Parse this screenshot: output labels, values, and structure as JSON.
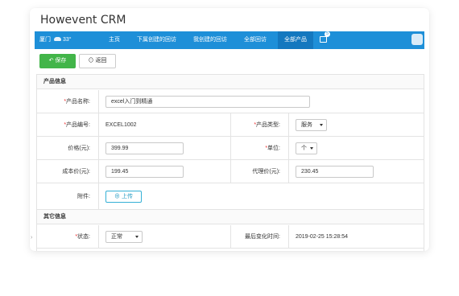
{
  "app": {
    "title": "Howevent CRM"
  },
  "navbar": {
    "city": "厦门",
    "temperature": "33°",
    "items": [
      "主页",
      "下属创建的回访",
      "我创建的回访",
      "全部回访",
      "全部产品"
    ],
    "active_index": 4,
    "message_count": "5"
  },
  "toolbar": {
    "save_label": "保存",
    "back_label": "返回"
  },
  "form": {
    "section_product": "产品信息",
    "product_name_label": "产品名称:",
    "product_name_value": "excel入门到精通",
    "product_code_label": "产品编号:",
    "product_code_value": "EXCEL1002",
    "product_type_label": "产品类型:",
    "product_type_value": "服务",
    "price_label": "价格(元):",
    "price_value": "399.99",
    "unit_label": "单位:",
    "unit_value": "个",
    "cost_label": "成本价(元):",
    "cost_value": "199.45",
    "agent_price_label": "代理价(元):",
    "agent_price_value": "230.45",
    "attachment_label": "附件:",
    "upload_label": "上传",
    "section_other": "其它信息",
    "status_label": "状态:",
    "status_value": "正常",
    "last_modified_label": "最后变化时间:",
    "last_modified_value": "2019-02-25 15:28:54"
  },
  "colors": {
    "nav": "#1e8fd8",
    "save": "#42b549",
    "required": "#ee3333",
    "upload": "#35b0d6"
  }
}
